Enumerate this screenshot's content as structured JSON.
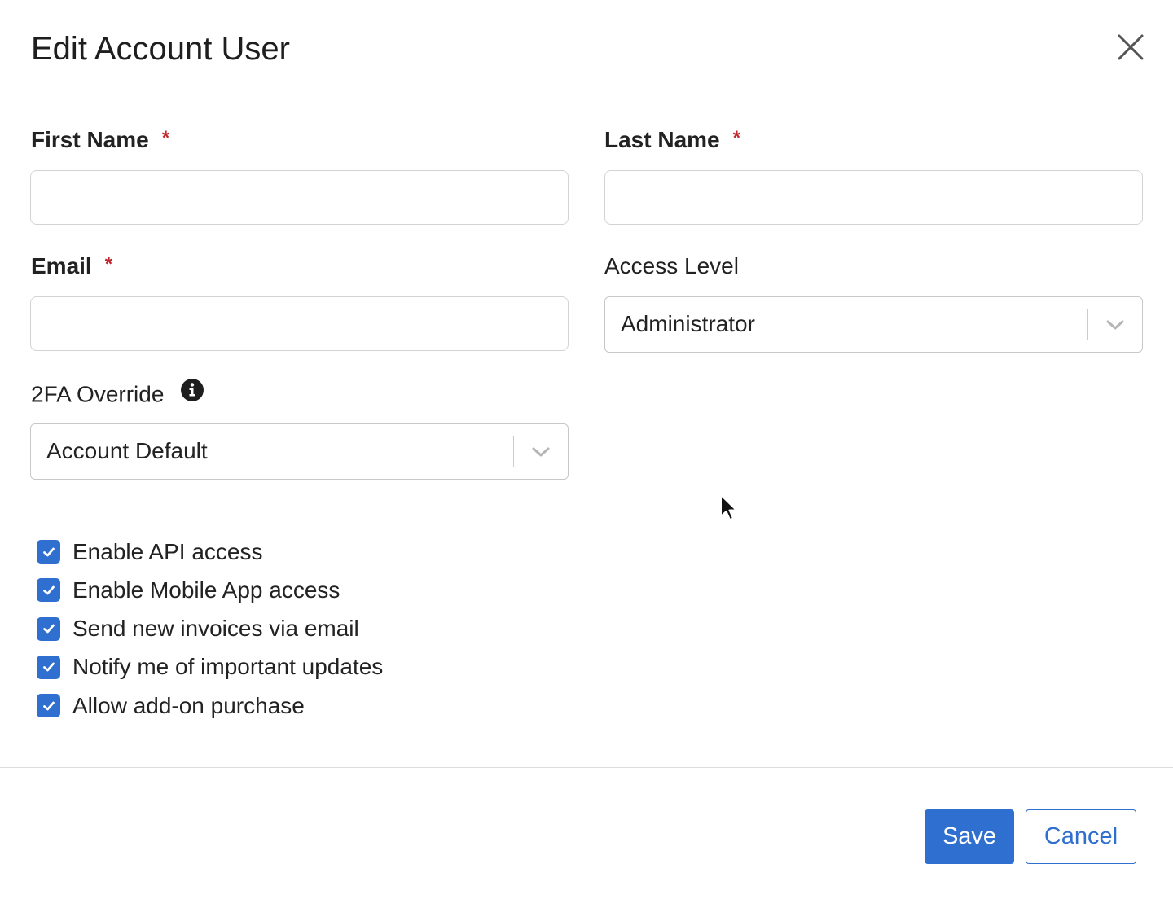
{
  "dialog": {
    "title": "Edit Account User",
    "close_icon": "close-icon"
  },
  "fields": {
    "first_name": {
      "label": "First Name",
      "required_mark": "*",
      "value": "",
      "placeholder": ""
    },
    "last_name": {
      "label": "Last Name",
      "required_mark": "*",
      "value": "",
      "placeholder": ""
    },
    "email": {
      "label": "Email",
      "required_mark": "*",
      "value": "",
      "placeholder": ""
    },
    "access_level": {
      "label": "Access Level",
      "value": "Administrator",
      "chevron_icon": "chevron-down-icon"
    },
    "twofa_override": {
      "label": "2FA Override",
      "info_icon": "info-icon",
      "value": "Account Default",
      "chevron_icon": "chevron-down-icon"
    }
  },
  "checkboxes": [
    {
      "label": "Enable API access",
      "checked": true
    },
    {
      "label": "Enable Mobile App access",
      "checked": true
    },
    {
      "label": "Send new invoices via email",
      "checked": true
    },
    {
      "label": "Notify me of important updates",
      "checked": true
    },
    {
      "label": "Allow add-on purchase",
      "checked": true
    }
  ],
  "footer": {
    "save_label": "Save",
    "cancel_label": "Cancel"
  },
  "colors": {
    "accent": "#2f6fd0",
    "required": "#c0272d",
    "border": "#d3d3d3",
    "divider": "#dcdcdc"
  }
}
